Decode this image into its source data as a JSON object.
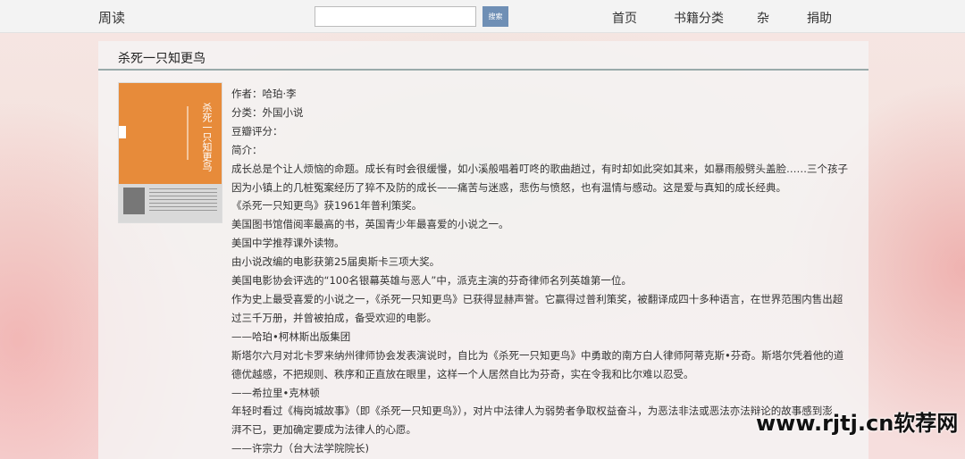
{
  "navbar": {
    "brand": "周读",
    "search_value": "",
    "search_button": "搜索",
    "links": [
      "首页",
      "书籍分类",
      "杂",
      "捐助"
    ]
  },
  "book": {
    "title": "杀死一只知更鸟",
    "cover_title": "杀死一只知更鸟",
    "author": "作者：哈珀·李",
    "category": "分类：外国小说",
    "rating": "豆瓣评分：",
    "intro_label": "简介：",
    "intro": [
      "成长总是个让人烦恼的命题。成长有时会很缓慢，如小溪般唱着叮咚的歌曲趟过，有时却如此突如其来，如暴雨般劈头盖脸……三个孩子",
      "因为小镇上的几桩冤案经历了猝不及防的成长——痛苦与迷惑，悲伤与愤怒，也有温情与感动。这是爱与真知的成长经典。",
      "《杀死一只知更鸟》获1961年普利策奖。",
      "美国图书馆借阅率最高的书，英国青少年最喜爱的小说之一。",
      "美国中学推荐课外读物。",
      "由小说改编的电影获第25届奥斯卡三项大奖。",
      "美国电影协会评选的“100名银幕英雄与恶人”中，派克主演的芬奇律师名列英雄第一位。",
      "作为史上最受喜爱的小说之一，《杀死一只知更鸟》已获得显赫声誉。它赢得过普利策奖，被翻译成四十多种语言，在世界范围内售出超",
      "过三千万册，并曾被拍成，备受欢迎的电影。",
      "——哈珀•柯林斯出版集团",
      "斯塔尔六月对北卡罗来纳州律师协会发表演说时，自比为《杀死一只知更鸟》中勇敢的南方白人律师阿蒂克斯•芬奇。斯塔尔凭着他的道",
      "德优越感，不把规则、秩序和正直放在眼里，这样一个人居然自比为芬奇，实在令我和比尔难以忍受。",
      "——希拉里•克林顿",
      "年轻时看过《梅岗城故事》（即《杀死一只知更鸟》），对片中法律人为弱势者争取权益奋斗，为恶法非法或恶法亦法辩论的故事感到澎",
      "湃不已，更加确定要成为法律人的心愿。",
      "——许宗力（台大法学院院长)"
    ]
  },
  "watermark": "www.rjtj.cn软荐网"
}
